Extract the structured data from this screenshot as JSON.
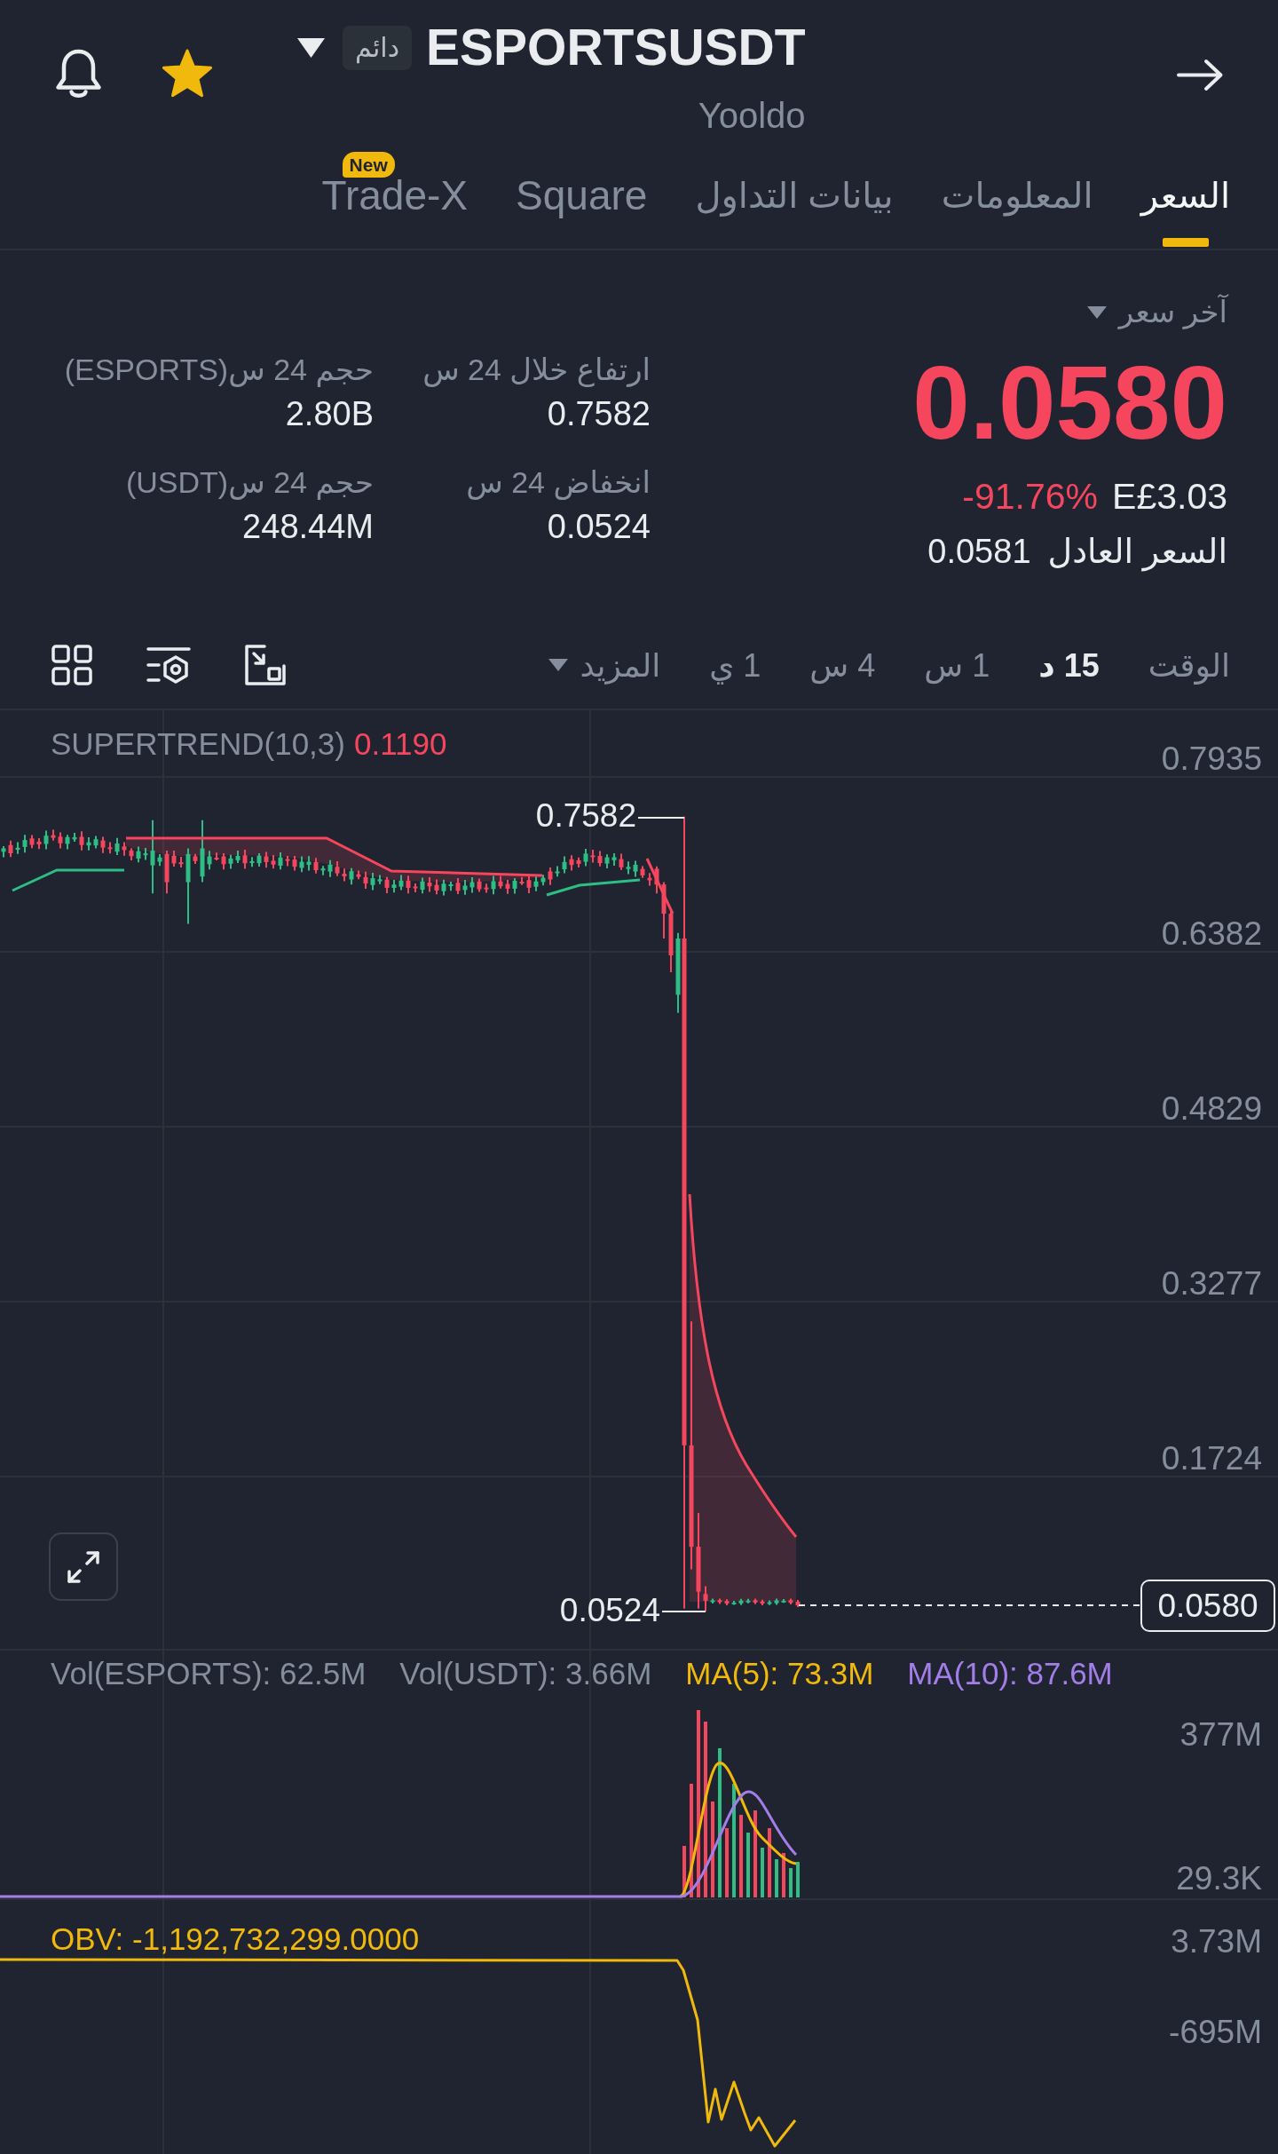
{
  "header": {
    "badge": "دائم",
    "pair": "ESPORTSUSDT",
    "subtitle": "Yooldo",
    "favorite": true
  },
  "tabs": [
    {
      "label": "السعر",
      "selected": true
    },
    {
      "label": "المعلومات",
      "selected": false
    },
    {
      "label": "بيانات التداول",
      "selected": false
    },
    {
      "label": "Square",
      "selected": false
    },
    {
      "label": "Trade-X",
      "selected": false,
      "badge": "New"
    }
  ],
  "price": {
    "label": "آخر سعر",
    "last": "0.0580",
    "negative": true,
    "change": "-91.76%",
    "fiat": "E£3.03",
    "fair_label": "السعر العادل",
    "fair_value": "0.0581"
  },
  "stats": [
    {
      "label": "ارتفاع خلال 24 س",
      "value": "0.7582"
    },
    {
      "label": "انخفاض 24 س",
      "value": "0.0524"
    },
    {
      "label": "حجم 24 س(ESPORTS)",
      "value": "2.80B"
    },
    {
      "label": "حجم 24 س(USDT)",
      "value": "248.44M"
    }
  ],
  "toolbar": {
    "intervals": [
      {
        "label": "الوقت",
        "selected": false
      },
      {
        "label": "15 د",
        "selected": true
      },
      {
        "label": "1 س",
        "selected": false
      },
      {
        "label": "4 س",
        "selected": false
      },
      {
        "label": "1 ي",
        "selected": false
      }
    ],
    "more": "المزيد"
  },
  "price_chart": {
    "indicator": "SUPERTREND(10,3)",
    "indicator_value": "0.1190",
    "negative": true,
    "yticks": [
      "0.7935",
      "0.6382",
      "0.4829",
      "0.3277",
      "0.1724"
    ],
    "high_label": "0.7582",
    "low_label": "0.0524",
    "last_price": "0.0580"
  },
  "volume_chart": {
    "legend": [
      {
        "text": "MA(10): 87.6M",
        "color": "#a47ee8"
      },
      {
        "text": "MA(5): 73.3M",
        "color": "#f0b90b"
      },
      {
        "text": "Vol(USDT): 3.66M",
        "color": "#848e9c"
      },
      {
        "text": "Vol(ESPORTS): 62.5M",
        "color": "#848e9c"
      }
    ],
    "yticks": [
      "377M",
      "29.3K"
    ]
  },
  "obv_chart": {
    "legend": "OBV: -1,192,732,299.0000",
    "yticks": [
      "3.73M",
      "-695M"
    ]
  }
}
